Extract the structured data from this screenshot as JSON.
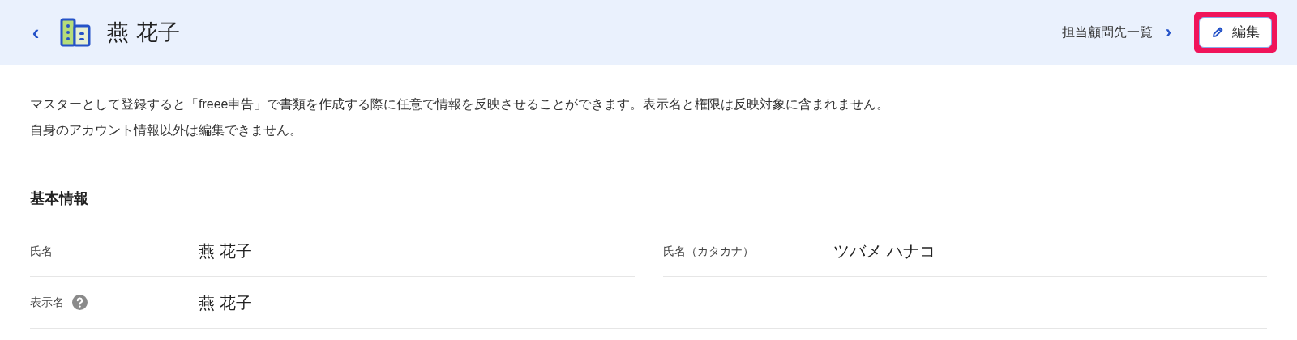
{
  "header": {
    "back": "‹",
    "title": "燕 花子",
    "link": "担当顧問先一覧",
    "link_arrow": "›",
    "edit_button": {
      "label": "編集",
      "highlighted": true
    }
  },
  "notice": [
    "マスターとして登録すると「freee申告」で書類を作成する際に任意で情報を反映させることができます。表示名と権限は反映対象に含まれません。",
    "自身のアカウント情報以外は編集できません。"
  ],
  "section_title": "基本情報",
  "rows": [
    [
      {
        "label": "氏名",
        "value": "燕 花子",
        "help": false
      },
      {
        "label": "氏名（カタカナ）",
        "value": "ツバメ ハナコ",
        "help": false
      }
    ],
    [
      {
        "label": "表示名",
        "value": "燕 花子",
        "help": true
      }
    ]
  ]
}
